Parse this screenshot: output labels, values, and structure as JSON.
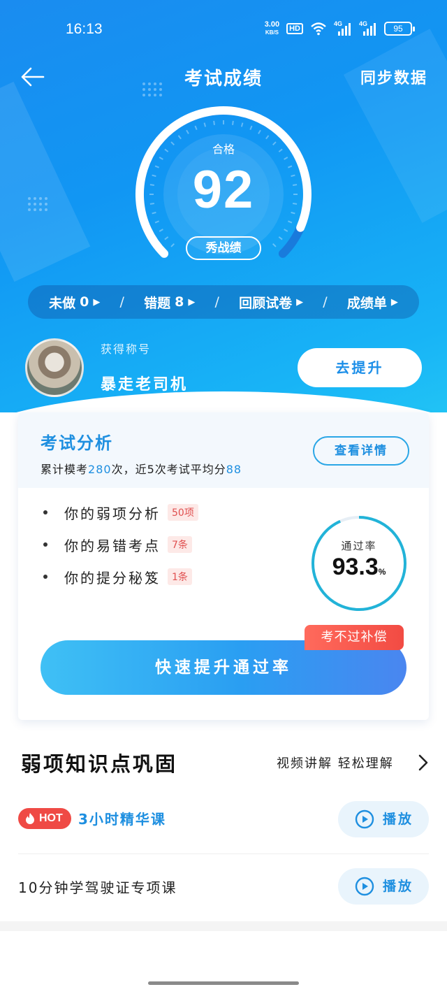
{
  "status_bar": {
    "time": "16:13",
    "net_speed_value": "3.00",
    "net_speed_unit": "KB/S",
    "hd_label": "HD",
    "signal1_label": "4G",
    "signal2_label": "4G",
    "battery": "95",
    "icons": [
      "wifi-icon",
      "signal-icon",
      "battery-icon"
    ]
  },
  "nav": {
    "title": "考试成绩",
    "sync_label": "同步数据",
    "back_icon": "arrow-left-icon"
  },
  "score": {
    "status": "合格",
    "value": "92",
    "score_fraction": 0.92,
    "share_label": "秀战绩"
  },
  "quick_links": [
    {
      "label": "未做",
      "count": "0"
    },
    {
      "label": "错题",
      "count": "8"
    },
    {
      "label": "回顾试卷",
      "count": ""
    },
    {
      "label": "成绩单",
      "count": ""
    }
  ],
  "quick_sep": "/",
  "profile": {
    "title_label": "获得称号",
    "title_name": "暴走老司机",
    "improve_label": "去提升"
  },
  "analysis": {
    "title": "考试分析",
    "summary_prefix": "累计模考",
    "total_count": "280",
    "summary_mid": "次，近5次考试平均分",
    "average": "88",
    "detail_label": "查看详情",
    "items": [
      {
        "label": "你的弱项分析",
        "badge": "50项"
      },
      {
        "label": "你的易错考点",
        "badge": "7条"
      },
      {
        "label": "你的提分秘笈",
        "badge": "1条"
      }
    ],
    "pass_rate_label": "通过率",
    "pass_rate_value": "93.3",
    "pass_rate_unit": "%",
    "pass_rate_fraction": 0.933,
    "compensate_label": "考不过补偿",
    "boost_label": "快速提升通过率"
  },
  "weak_section": {
    "title": "弱项知识点巩固",
    "subtitle": "视频讲解 轻松理解",
    "courses": [
      {
        "hot_label": "HOT",
        "name": "3小时精华课",
        "play_label": "播放"
      },
      {
        "name": "10分钟学驾驶证专项课",
        "play_label": "播放"
      }
    ]
  },
  "colors": {
    "accent": "#1e8fe0",
    "hero_start": "#1a8cf0",
    "hero_end": "#21c3f5",
    "hot": "#ef4a45",
    "badge_text": "#e05050"
  }
}
